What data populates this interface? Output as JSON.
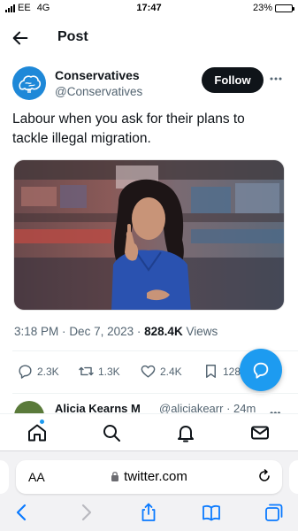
{
  "status_bar": {
    "carrier": "EE",
    "network": "4G",
    "time": "17:47",
    "battery": "23%",
    "battery_level": 0.23
  },
  "header": {
    "title": "Post"
  },
  "tweet": {
    "author_name": "Conservatives",
    "author_handle": "@Conservatives",
    "follow_label": "Follow",
    "text": "Labour when you ask for their plans to tackle illegal migration.",
    "time": "3:18 PM",
    "date": "Dec 7, 2023",
    "separator": "·",
    "views_count": "828.4K",
    "views_label": "Views",
    "replies": "2.3K",
    "reposts": "1.3K",
    "likes": "2.4K",
    "bookmarks": "128"
  },
  "next_reply": {
    "name": "Alicia Kearns M",
    "handle": "@aliciakearr",
    "time": "· 24m"
  },
  "browser": {
    "aa_label": "AA",
    "url": "twitter.com"
  },
  "colors": {
    "accent": "#1d9bf0",
    "text": "#0f1419",
    "secondary_text": "#536471",
    "follow_button": "#0f1419",
    "conservatives_brand": "#1e88d8",
    "safari_blue": "#0a7aff"
  },
  "icons": {
    "back": "arrow-left-icon",
    "more": "more-horizontal-icon",
    "reply": "reply-icon",
    "repost": "repost-icon",
    "like": "heart-icon",
    "bookmark": "bookmark-icon",
    "fab": "message-bubble-icon",
    "home": "home-icon",
    "search": "search-icon",
    "notifications": "bell-icon",
    "messages": "mail-icon",
    "lock": "lock-icon",
    "reload": "reload-icon",
    "browser_back": "chevron-left-icon",
    "browser_forward": "chevron-right-icon",
    "share": "share-icon",
    "bookmarks_browser": "book-icon",
    "tabs": "tabs-icon"
  }
}
